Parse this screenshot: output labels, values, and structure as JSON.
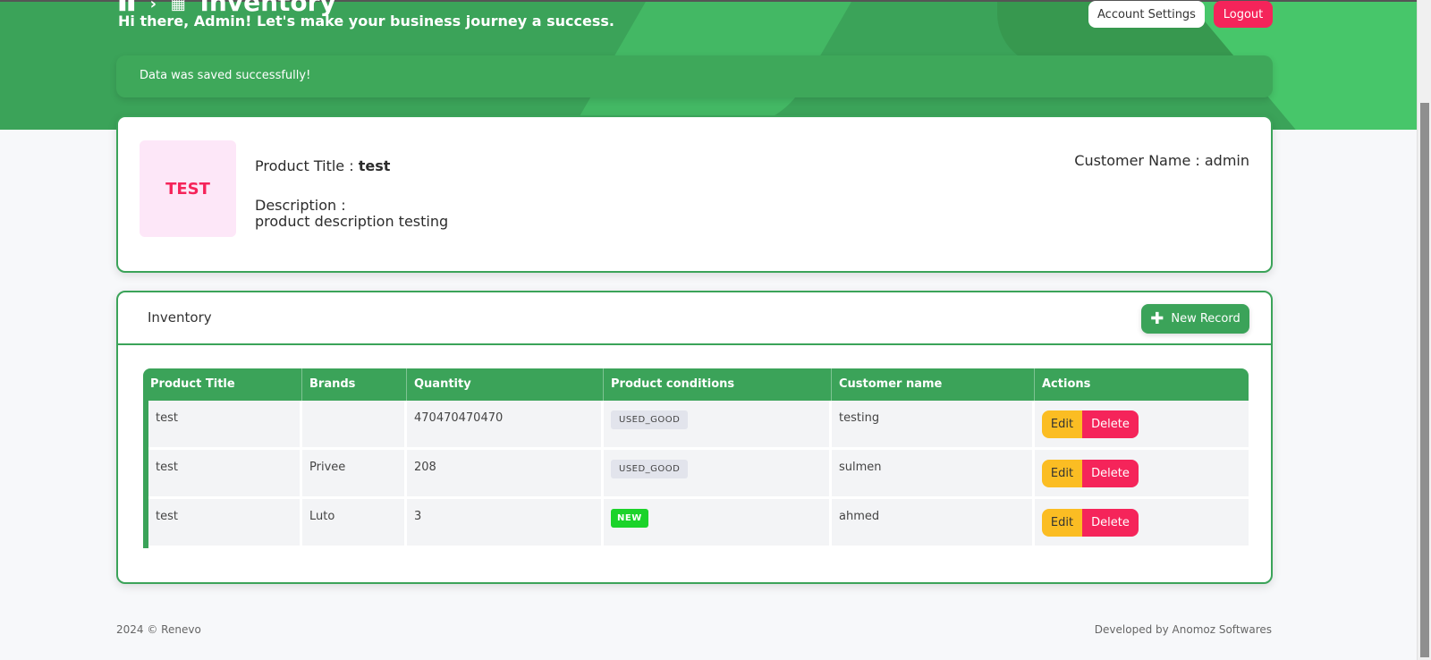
{
  "header": {
    "breadcrumb_home_icon": "home-icon",
    "breadcrumb_sep": "›",
    "breadcrumb_section_icon": "grid-icon",
    "page_title": "Inventory",
    "greeting": "Hi there, Admin! Let's make your business journey a success.",
    "account_settings_label": "Account Settings",
    "logout_label": "Logout"
  },
  "alert": {
    "message": "Data was saved successfully!"
  },
  "product": {
    "thumb_text": "TEST",
    "title_label": "Product Title : ",
    "title_value": "test",
    "description_label": "Description :",
    "description_value": "product description testing",
    "customer_label": "Customer Name : ",
    "customer_value": "admin"
  },
  "inventory": {
    "title": "Inventory",
    "new_record_label": "New Record",
    "columns": [
      "Product Title",
      "Brands",
      "Quantity",
      "Product conditions",
      "Customer name",
      "Actions"
    ],
    "rows": [
      {
        "title": "test",
        "brand": "",
        "quantity": "470470470470",
        "condition": "USED_GOOD",
        "customer": "testing"
      },
      {
        "title": "test",
        "brand": "Privee",
        "quantity": "208",
        "condition": "USED_GOOD",
        "customer": "sulmen"
      },
      {
        "title": "test",
        "brand": "Luto",
        "quantity": "3",
        "condition": "NEW",
        "customer": "ahmed"
      }
    ],
    "edit_label": "Edit",
    "delete_label": "Delete"
  },
  "footer": {
    "left": "2024  © Renevo",
    "right": "Developed by Anomoz Softwares"
  },
  "colors": {
    "primary": "#3ba359",
    "danger": "#f5245a",
    "warning": "#fbbd23",
    "new_badge": "#1bd32a"
  }
}
